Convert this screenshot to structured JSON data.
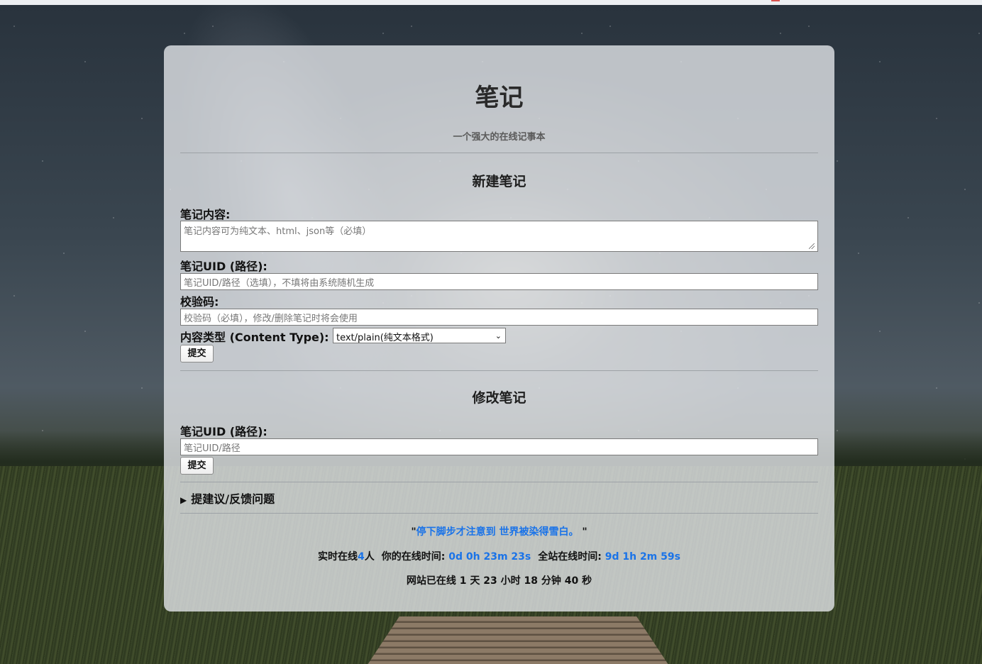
{
  "page": {
    "title": "笔记",
    "subtitle": "一个强大的在线记事本"
  },
  "new_note": {
    "heading": "新建笔记",
    "content_label": "笔记内容:",
    "content_placeholder": "笔记内容可为纯文本、html、json等（必填）",
    "uid_label": "笔记UID (路径):",
    "uid_placeholder": "笔记UID/路径（选填），不填将由系统随机生成",
    "code_label": "校验码:",
    "code_placeholder": "校验码（必填），修改/删除笔记时将会使用",
    "content_type_label": "内容类型 (Content Type):",
    "content_type_selected": "text/plain(纯文本格式)",
    "submit_label": "提交"
  },
  "edit_note": {
    "heading": "修改笔记",
    "uid_label": "笔记UID (路径):",
    "uid_placeholder": "笔记UID/路径",
    "submit_label": "提交"
  },
  "feedback": {
    "label": "提建议/反馈问题"
  },
  "footer": {
    "quote_open": "\"",
    "quote_text": "停下脚步才注意到 世界被染得雪白。",
    "quote_close": " \"",
    "online_prefix": "实时在线",
    "online_count": "4",
    "online_suffix": "人",
    "your_time_label": "你的在线时间:",
    "your_time_value": "0d 0h 23m 23s",
    "site_time_label": "全站在线时间:",
    "site_time_value": "9d 1h 2m 59s",
    "uptime_text": "网站已在线 1 天 23 小时 18 分钟 40 秒"
  },
  "colors": {
    "link_blue": "#1a73e8",
    "card_bg": "rgba(226,229,232,0.80)"
  },
  "icons": {
    "resize": "resize-grip-icon",
    "disclosure": "disclosure-triangle-icon",
    "dropdown": "chevron-down-icon"
  }
}
